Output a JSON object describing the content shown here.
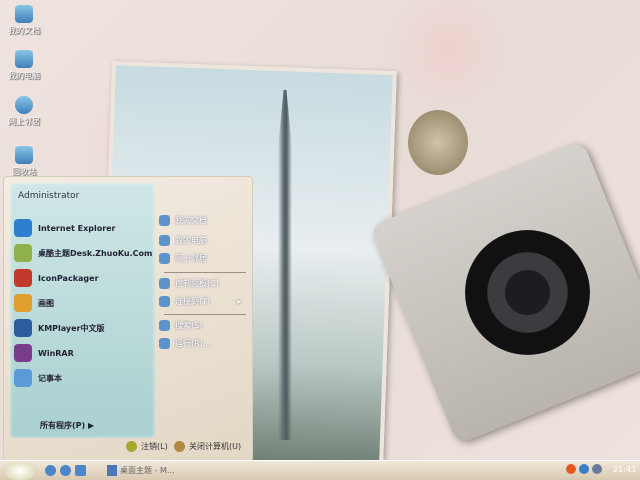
{
  "desktop": {
    "icons": [
      {
        "label": "我的文档"
      },
      {
        "label": "我的电脑"
      },
      {
        "label": "网上邻居"
      },
      {
        "label": "回收站"
      }
    ]
  },
  "start_menu": {
    "user": "Administrator",
    "programs": [
      {
        "label": "Internet Explorer",
        "icon": "ie-icon",
        "color": "#2f7fd1"
      },
      {
        "label": "桌酷主题Desk.ZhuoKu.Com",
        "icon": "zhuoku-icon",
        "color": "#8fb04c"
      },
      {
        "label": "IconPackager",
        "icon": "iconpackager-icon",
        "color": "#c0392b"
      },
      {
        "label": "画图",
        "icon": "paint-icon",
        "color": "#e0a030"
      },
      {
        "label": "KMPlayer中文版",
        "icon": "kmplayer-icon",
        "color": "#2c5e9e"
      },
      {
        "label": "WinRAR",
        "icon": "winrar-icon",
        "color": "#7a3d8c"
      },
      {
        "label": "记事本",
        "icon": "notepad-icon",
        "color": "#5a9ad6"
      }
    ],
    "all_programs": "所有程序(P)",
    "right": [
      {
        "label": "我的文档",
        "icon": "my-documents-icon"
      },
      {
        "label": "我的电脑",
        "icon": "my-computer-icon"
      },
      {
        "label": "网上邻居",
        "icon": "network-icon"
      },
      {
        "label": "控制面板(C)",
        "icon": "control-panel-icon"
      },
      {
        "label": "连接到(T)",
        "icon": "connect-icon"
      },
      {
        "label": "搜索(S)",
        "icon": "search-icon"
      },
      {
        "label": "运行(R)...",
        "icon": "run-icon"
      }
    ],
    "logoff": "注销(L)",
    "shutdown": "关闭计算机(U)"
  },
  "taskbar": {
    "task": "桌面主题 - M...",
    "clock": "21:43"
  }
}
